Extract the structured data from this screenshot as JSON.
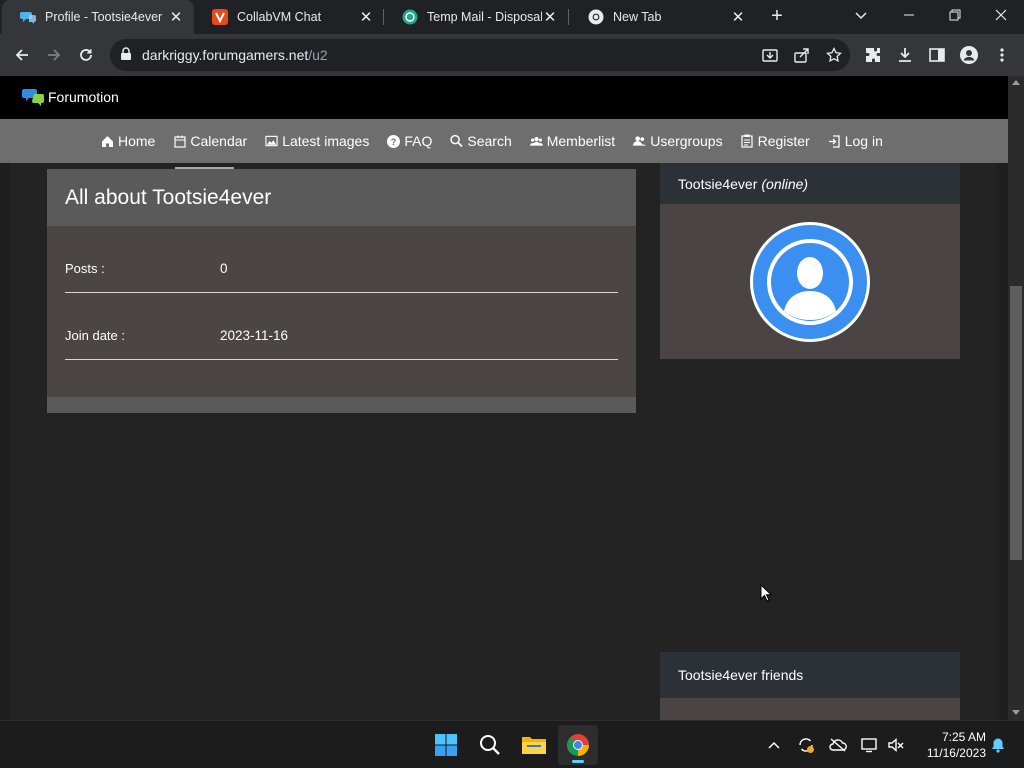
{
  "browser": {
    "tabs": [
      {
        "title": "Profile - Tootsie4ever",
        "active": true,
        "icon": "forumotion-chat-icon"
      },
      {
        "title": "CollabVM Chat",
        "active": false,
        "icon": "vivaldi-icon"
      },
      {
        "title": "Temp Mail - Disposable",
        "active": false,
        "icon": "tempmail-icon"
      },
      {
        "title": "New Tab",
        "active": false,
        "icon": "chrome-icon"
      }
    ],
    "url_domain": "darkriggy.forumgamers.net",
    "url_path": "/u2"
  },
  "site": {
    "brand": "Forumotion",
    "nav": [
      {
        "label": "Home",
        "icon": "home-icon"
      },
      {
        "label": "Calendar",
        "icon": "calendar-icon"
      },
      {
        "label": "Latest images",
        "icon": "images-icon"
      },
      {
        "label": "FAQ",
        "icon": "help-icon"
      },
      {
        "label": "Search",
        "icon": "search-icon"
      },
      {
        "label": "Memberlist",
        "icon": "members-icon"
      },
      {
        "label": "Usergroups",
        "icon": "usergroups-icon"
      },
      {
        "label": "Register",
        "icon": "register-icon"
      },
      {
        "label": "Log in",
        "icon": "login-icon"
      }
    ]
  },
  "profile": {
    "heading": "All about Tootsie4ever",
    "rows": [
      {
        "label": "Posts :",
        "value": "0"
      },
      {
        "label": "Join date :",
        "value": "2023-11-16"
      }
    ]
  },
  "sidebar": {
    "username": "Tootsie4ever",
    "status": "(online)",
    "friends_title": "Tootsie4ever friends"
  },
  "taskbar": {
    "time": "7:25 AM",
    "date": "11/16/2023"
  },
  "colors": {
    "nav_bg": "#6e6e6e",
    "card_bg": "#4a4544",
    "avatar_blue": "#3b8ff0",
    "sidebar_header": "#2c3138"
  }
}
